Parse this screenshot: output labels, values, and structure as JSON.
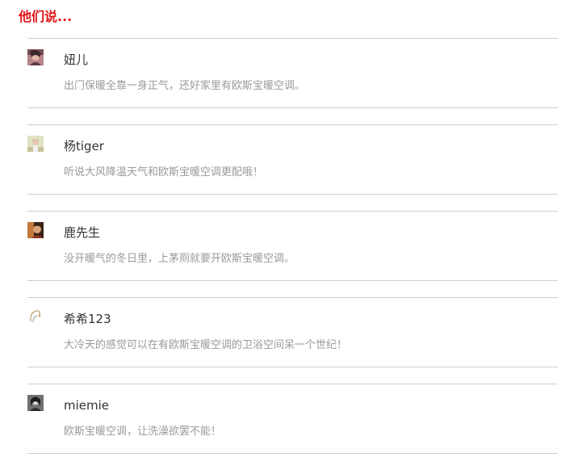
{
  "heading": "他们说...",
  "comments": [
    {
      "name": "妞儿",
      "text": "出门保暖全靠一身正气，还好家里有欧斯宝暖空调。",
      "avatar_icon": "avatar-photo-icon"
    },
    {
      "name": "杨tiger",
      "text": "听说大风降温天气和欧斯宝暖空调更配哦！",
      "avatar_icon": "avatar-photo-icon"
    },
    {
      "name": "鹿先生",
      "text": "没开暖气的冬日里，上茅厕就要开欧斯宝暖空调。",
      "avatar_icon": "avatar-photo-icon"
    },
    {
      "name": "希希123",
      "text": "大冷天的感觉可以在有欧斯宝暖空调的卫浴空间呆一个世纪！",
      "avatar_icon": "avatar-sketch-icon"
    },
    {
      "name": "miemie",
      "text": "欧斯宝暖空调，让洗澡欲罢不能！",
      "avatar_icon": "avatar-photo-icon"
    }
  ],
  "colors": {
    "heading": "#e01418",
    "name": "#333333",
    "comment": "#9a9a9a",
    "divider": "#cfcfcf"
  }
}
